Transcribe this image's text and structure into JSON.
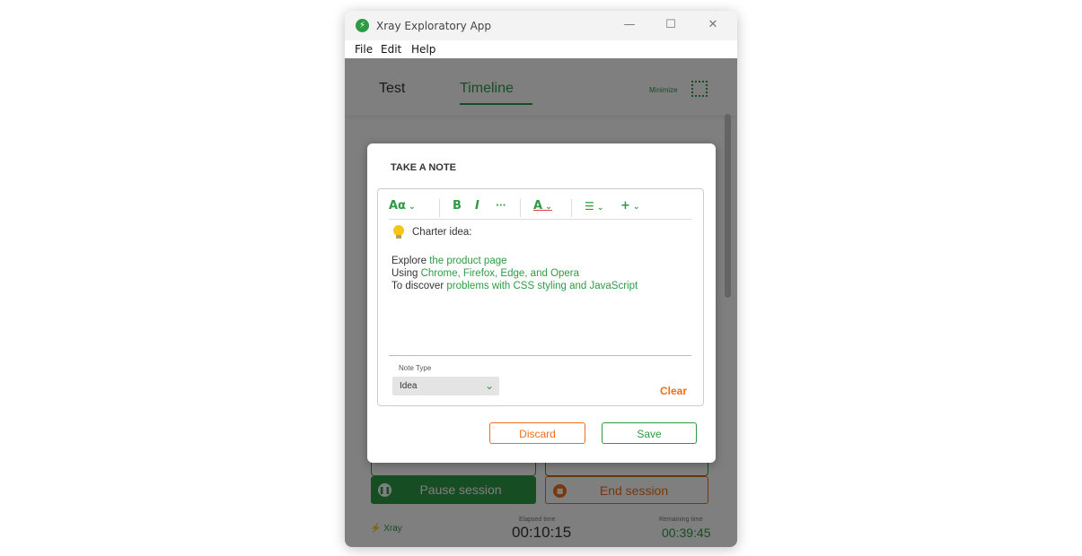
{
  "window": {
    "title": "Xray Exploratory App",
    "icon": "bolt-icon",
    "controls": {
      "minimize": "—",
      "maximize": "☐",
      "close": "✕"
    }
  },
  "menubar": {
    "items": [
      "File",
      "Edit",
      "Help"
    ]
  },
  "tabs": [
    {
      "label": "Test",
      "active": false
    },
    {
      "label": "Timeline",
      "active": true
    }
  ],
  "minimize_label": "Minimize",
  "session": {
    "pause_label": "Pause session",
    "end_label": "End session",
    "logo_text": "Xray",
    "elapsed_label": "Elapsed time",
    "elapsed_value": "00:10:15",
    "remaining_label": "Remaining time",
    "remaining_value": "00:39:45"
  },
  "note_modal": {
    "title": "TAKE A NOTE",
    "toolbar": {
      "font_style": "Aα",
      "bold": "B",
      "italic": "I",
      "more": "···",
      "text_color": "A",
      "list": "☰",
      "insert": "+"
    },
    "charter_label": "Charter idea:",
    "lines": [
      {
        "prefix": "Explore ",
        "link": "the product page"
      },
      {
        "prefix": "Using ",
        "link": "Chrome, Firefox, Edge, and Opera"
      },
      {
        "prefix": "To discover ",
        "link": "problems with CSS styling and JavaScript"
      }
    ],
    "note_type_label": "Note Type",
    "note_type_value": "Idea",
    "clear_label": "Clear",
    "discard_label": "Discard",
    "save_label": "Save"
  },
  "colors": {
    "brand_green": "#2c9b44",
    "accent_orange": "#f26e1a"
  }
}
